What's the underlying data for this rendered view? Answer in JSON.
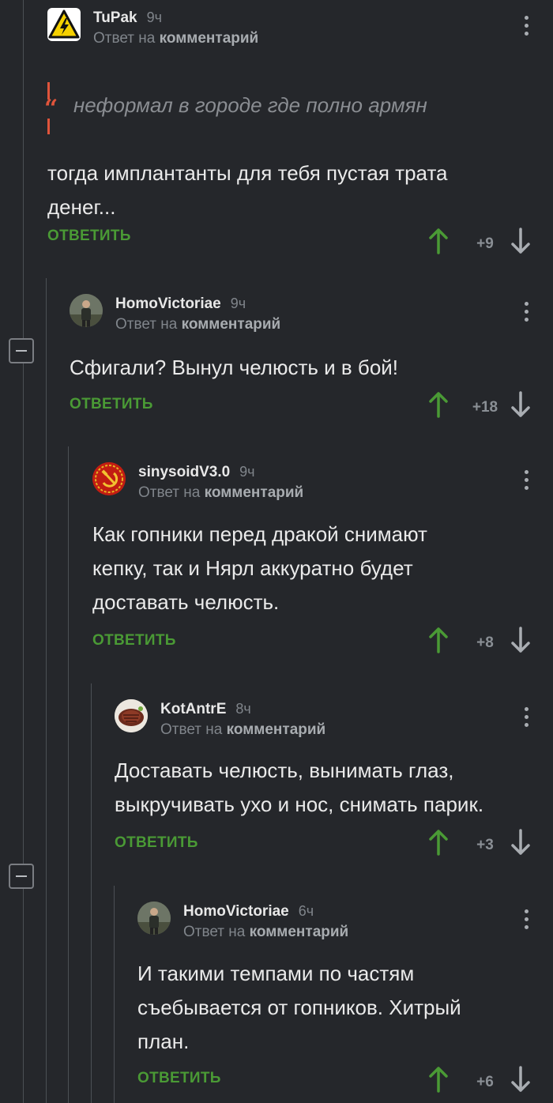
{
  "comments": [
    {
      "user": "TuPak",
      "time": "9ч",
      "reply_prefix": "Ответ на",
      "reply_link": "комментарий",
      "quote": "неформал в городе где полно армян",
      "lines": [
        "тогда имплантанты для тебя пустая трата",
        "денег..."
      ],
      "action": "ОТВЕТИТЬ",
      "score": "+9",
      "avatar_icon": "high-voltage-icon"
    },
    {
      "user": "HomoVictoriae",
      "time": "9ч",
      "reply_prefix": "Ответ на",
      "reply_link": "комментарий",
      "lines": [
        "Сфигали? Вынул челюсть и в бой!"
      ],
      "action": "ОТВЕТИТЬ",
      "score": "+18",
      "avatar_icon": "person-photo-avatar"
    },
    {
      "user": "sinysoidV3.0",
      "time": "9ч",
      "reply_prefix": "Ответ на",
      "reply_link": "комментарий",
      "lines": [
        "Как гопники перед дракой снимают",
        "кепку, так и Нярл аккуратно будет",
        "доставать челюсть."
      ],
      "action": "ОТВЕТИТЬ",
      "score": "+8",
      "avatar_icon": "hammer-sickle-emblem-avatar"
    },
    {
      "user": "KotAntrE",
      "time": "8ч",
      "reply_prefix": "Ответ на",
      "reply_link": "комментарий",
      "lines": [
        "Доставать челюсть, вынимать глаз,",
        "выкручивать ухо и нос, снимать парик."
      ],
      "action": "ОТВЕТИТЬ",
      "score": "+3",
      "avatar_icon": "steak-photo-avatar"
    },
    {
      "user": "HomoVictoriae",
      "time": "6ч",
      "reply_prefix": "Ответ на",
      "reply_link": "комментарий",
      "lines": [
        "И такими темпами по частям",
        "съебывается от гопников. Хитрый",
        "план."
      ],
      "action": "ОТВЕТИТЬ",
      "score": "+6",
      "avatar_icon": "person-photo-avatar"
    }
  ],
  "colors": {
    "background": "#25272b",
    "accent_green": "#4a9a35",
    "quote_red": "#e0543b",
    "muted": "#80858b"
  }
}
